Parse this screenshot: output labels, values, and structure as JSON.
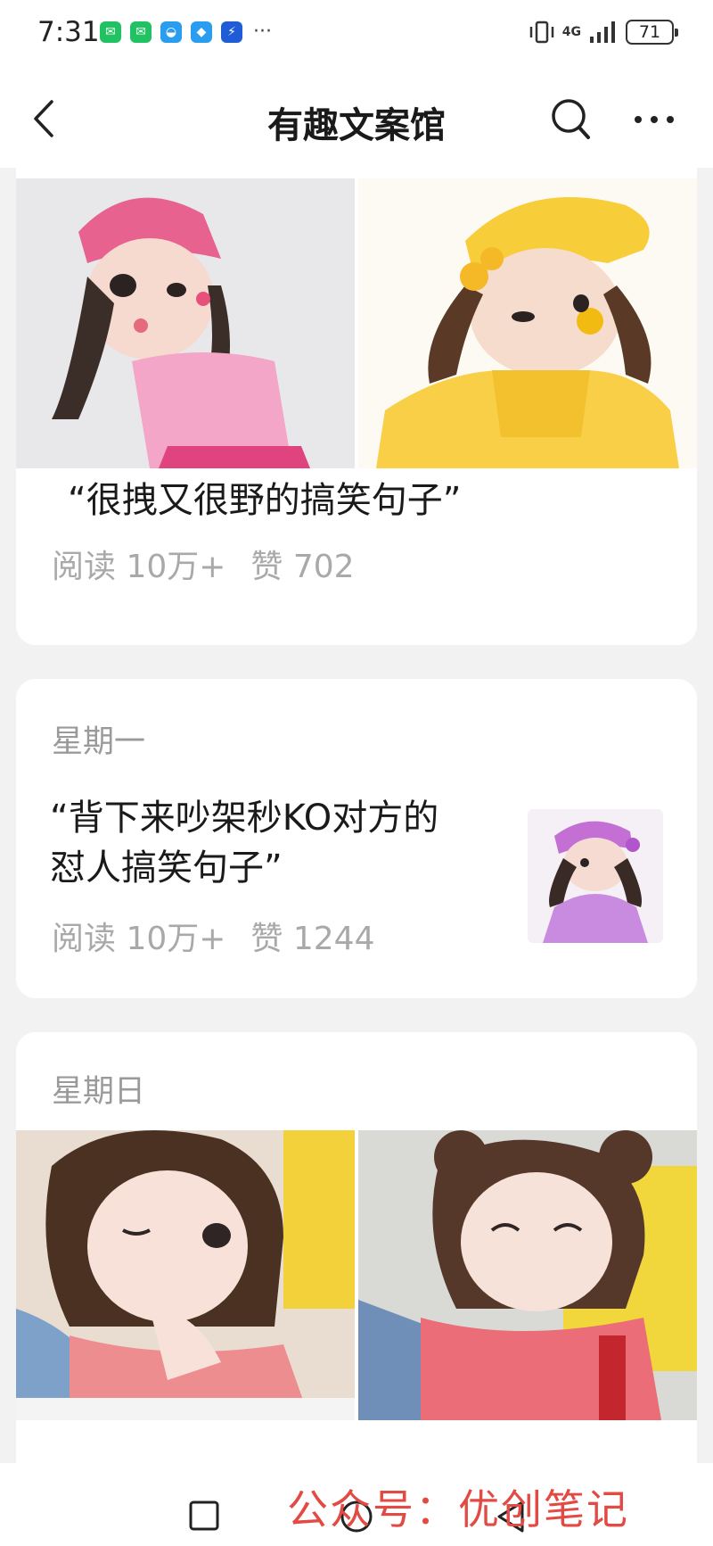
{
  "status_bar": {
    "time": "7:31",
    "network": "4G",
    "battery": "71",
    "more_glyph": "···"
  },
  "nav": {
    "title": "有趣文案馆",
    "back_icon": "chevron-left-icon",
    "search_icon": "search-icon",
    "more_icon": "more-dots-icon"
  },
  "articles": [
    {
      "title": "“很拽又很野的搞笑句子”",
      "reads_label": "阅读 10万+",
      "likes_label": "赞 702"
    },
    {
      "day": "星期一",
      "title_line1": "“背下来吵架秒KO对方的",
      "title_line2": "怼人搞笑句子”",
      "reads_label": "阅读 10万+",
      "likes_label": "赞 1244"
    },
    {
      "day": "星期日"
    }
  ],
  "watermark": "公众号：优创笔记",
  "colors": {
    "background": "#f2f2f2",
    "card": "#ffffff",
    "meta_text": "#a9a9a9",
    "watermark": "#e24a44"
  }
}
